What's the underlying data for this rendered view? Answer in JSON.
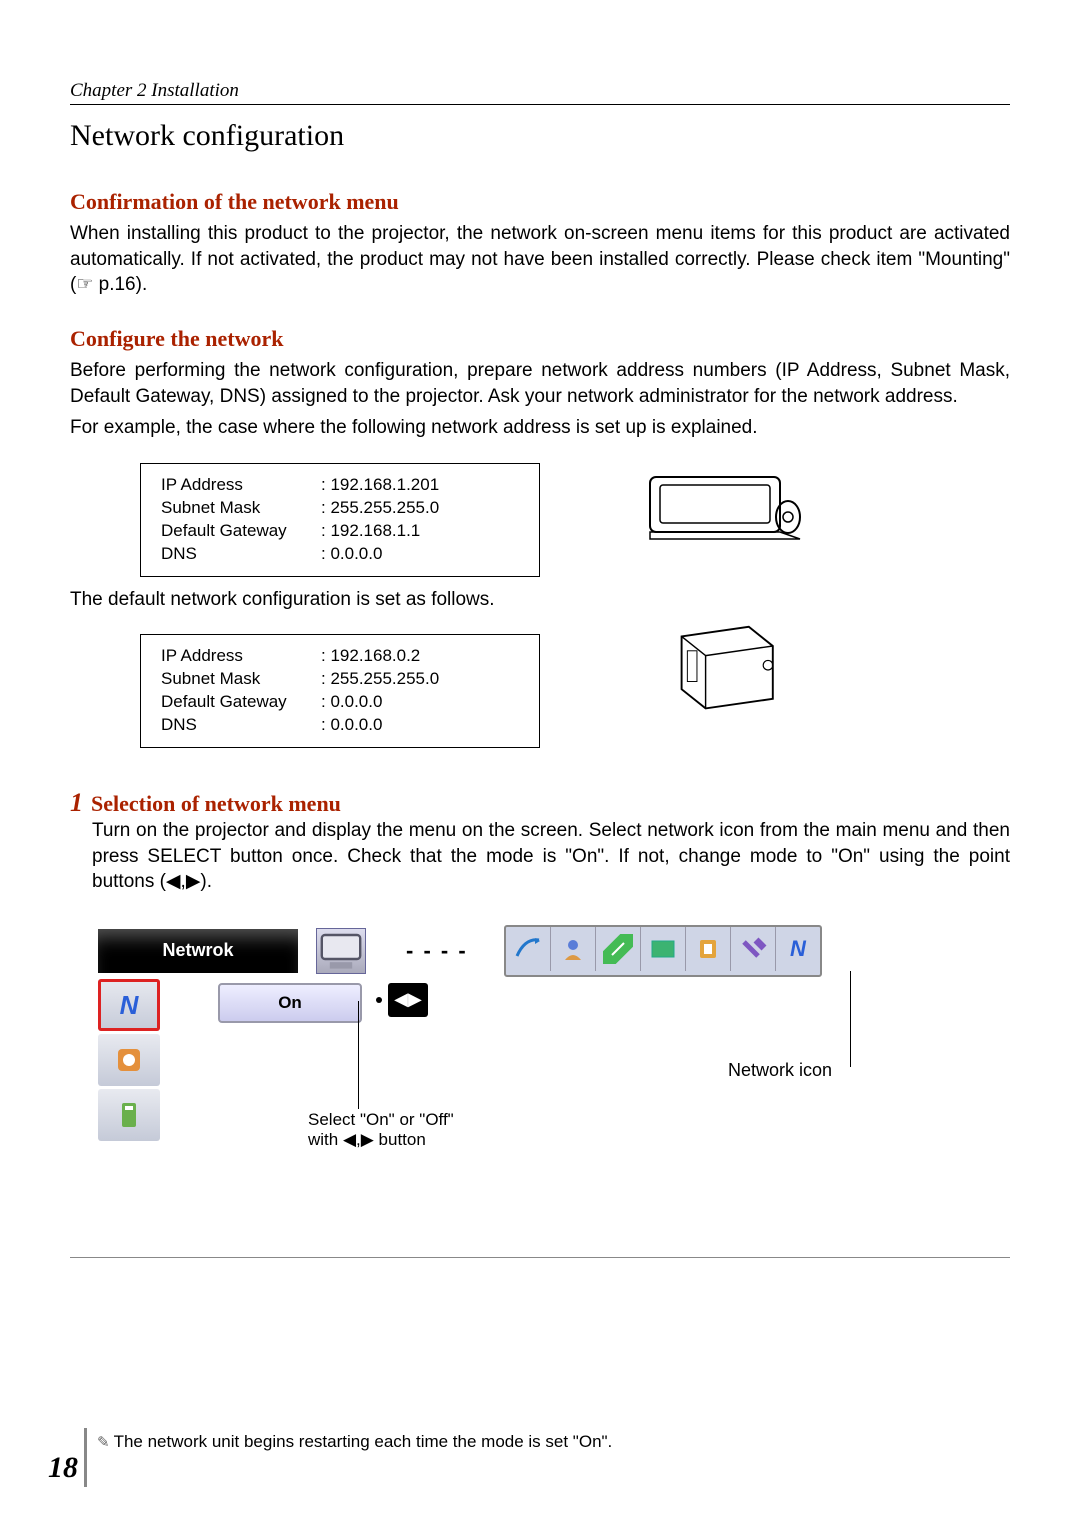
{
  "chapter": "Chapter 2 Installation",
  "section_title": "Network configuration",
  "sub1": {
    "heading": "Confirmation of the network menu",
    "body": "When installing this product to the projector, the network on-screen menu items for this product are activated automatically. If not activated, the product may not have been installed correctly. Please check item \"Mounting\" (☞ p.16)."
  },
  "sub2": {
    "heading": "Configure the network",
    "body1": "Before performing the network configuration, prepare network address numbers (IP Address, Subnet Mask, Default Gateway, DNS) assigned to the projector. Ask your network administrator for the network address.",
    "body2": "For example, the case where the following network address is set up is explained.",
    "body3": "The default network configuration is set as follows."
  },
  "example_config": {
    "ip_label": "IP Address",
    "ip_value": "192.168.1.201",
    "mask_label": "Subnet Mask",
    "mask_value": "255.255.255.0",
    "gw_label": "Default Gateway",
    "gw_value": "192.168.1.1",
    "dns_label": "DNS",
    "dns_value": "0.0.0.0"
  },
  "default_config": {
    "ip_label": "IP Address",
    "ip_value": "192.168.0.2",
    "mask_label": "Subnet Mask",
    "mask_value": "255.255.255.0",
    "gw_label": "Default Gateway",
    "gw_value": "0.0.0.0",
    "dns_label": "DNS",
    "dns_value": "0.0.0.0"
  },
  "step1": {
    "num": "1",
    "title": "Selection of network menu",
    "body": "Turn on the projector and display the menu on the screen. Select network icon from the main menu and then press SELECT button once. Check that the mode is \"On\". If not, change mode to \"On\" using the point buttons (◀,▶)."
  },
  "osd": {
    "label": "Netwrok",
    "dashes": "- - - -",
    "on_value": "On",
    "pointer_text1": "Select \"On\" or \"Off\"",
    "pointer_text2": "with ◀,▶ button",
    "network_icon_label": "Network icon"
  },
  "footnote": "The network unit begins restarting each time the mode is set \"On\".",
  "page_number": "18"
}
